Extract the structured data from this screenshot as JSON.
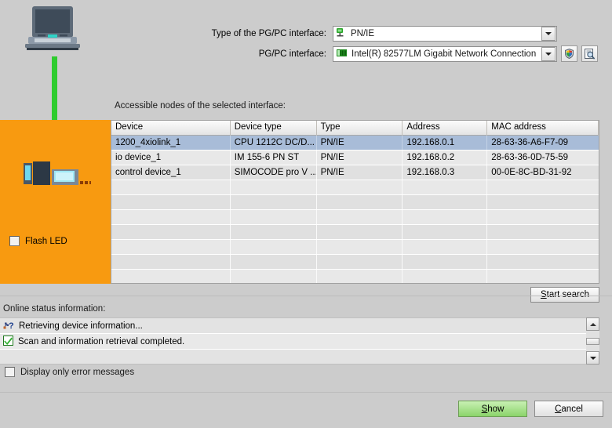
{
  "form": {
    "type_label": "Type of the PG/PC interface:",
    "type_value": "PN/IE",
    "type_icon": "pnie-green-icon",
    "iface_label": "PG/PC interface:",
    "iface_value": "Intel(R) 82577LM Gigabit Network Connection",
    "iface_icon": "network-card-icon",
    "shield_button_icon": "shield-icon",
    "properties_button_icon": "magnifier-document-icon"
  },
  "graphic": {
    "laptop_icon": "laptop-icon",
    "cable_color": "#2ecc2e",
    "panel_color": "#f89a10",
    "plc_icon": "plc-rack-icon",
    "flash_led_label": "Flash LED",
    "flash_led_checked": false
  },
  "table": {
    "caption": "Accessible nodes of the selected interface:",
    "columns": [
      "Device",
      "Device type",
      "Type",
      "Address",
      "MAC address"
    ],
    "rows": [
      {
        "device": "1200_4xiolink_1",
        "device_type": "CPU 1212C DC/D...",
        "type": "PN/IE",
        "address": "192.168.0.1",
        "mac": "28-63-36-A6-F7-09",
        "selected": true
      },
      {
        "device": "io device_1",
        "device_type": "IM 155-6 PN ST",
        "type": "PN/IE",
        "address": "192.168.0.2",
        "mac": "28-63-36-0D-75-59",
        "selected": false
      },
      {
        "device": "control device_1",
        "device_type": "SIMOCODE pro V ...",
        "type": "PN/IE",
        "address": "192.168.0.3",
        "mac": "00-0E-8C-BD-31-92",
        "selected": false
      }
    ],
    "empty_row_count": 8
  },
  "actions": {
    "start_search": "Start search",
    "start_search_accel": "S",
    "show": "Show",
    "show_accel": "S",
    "cancel": "Cancel",
    "cancel_accel": "C"
  },
  "status": {
    "title": "Online status information:",
    "messages": [
      {
        "icon": "scan-network-icon",
        "text": "Retrieving device information..."
      },
      {
        "icon": "check-green-icon",
        "text": "Scan and information retrieval completed."
      }
    ],
    "display_only_errors_label": "Display only error messages",
    "display_only_errors_checked": false,
    "scroll_up_icon": "chevron-up-icon",
    "scroll_down_icon": "chevron-down-icon"
  },
  "colors": {
    "background": "#cccccc",
    "orange_panel": "#f89a10",
    "selection_blue": "#a8bcd8",
    "accept_green": "#8bd46a",
    "cable_green": "#2ecc2e"
  }
}
